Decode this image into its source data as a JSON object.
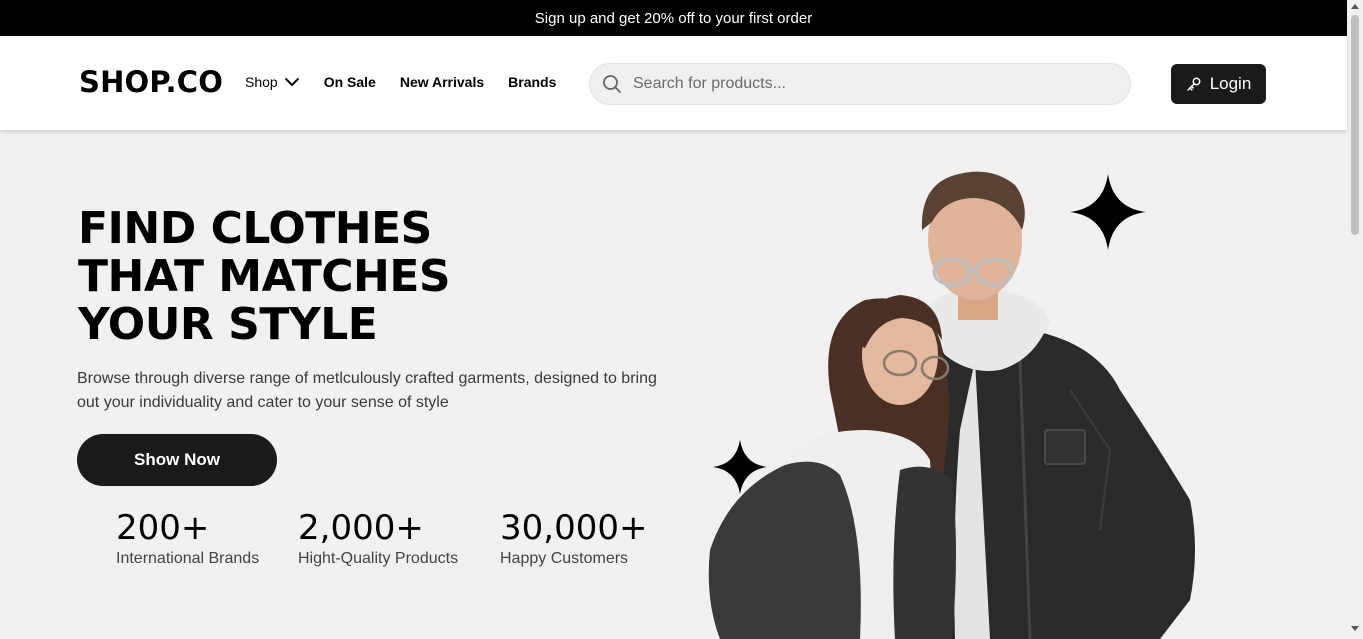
{
  "promo": {
    "text": "Sign up and get 20% off to your first order"
  },
  "header": {
    "logo": "SHOP.CO",
    "nav": [
      {
        "label": "Shop",
        "has_dropdown": true,
        "icon": "chevron-down-icon"
      },
      {
        "label": "On Sale"
      },
      {
        "label": "New Arrivals"
      },
      {
        "label": "Brands"
      }
    ],
    "search": {
      "placeholder": "Search for products...",
      "value": "",
      "icon": "search-icon"
    },
    "login": {
      "label": "Login",
      "icon": "key-icon"
    }
  },
  "hero": {
    "title_lines": [
      "FIND CLOTHES",
      "THAT MATCHES",
      "YOUR STYLE"
    ],
    "description": "Browse through diverse range of metlculously crafted garments, designed to bring out your individuality and cater to your sense of style",
    "cta_label": "Show Now",
    "stats": [
      {
        "value": "200+",
        "label": "International Brands"
      },
      {
        "value": "2,000+",
        "label": "Hight-Quality Products"
      },
      {
        "value": "30,000+",
        "label": "Happy Customers"
      }
    ],
    "decor_icons": [
      "sparkle-star-icon",
      "sparkle-star-icon"
    ]
  },
  "colors": {
    "promo_bg": "#000000",
    "hero_bg": "#F2F0F1",
    "button_bg": "#1A1A1A",
    "search_bg": "#F0F0F0"
  }
}
